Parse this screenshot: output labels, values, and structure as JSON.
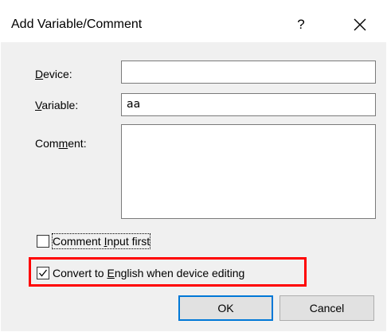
{
  "window": {
    "title": "Add Variable/Comment",
    "help_glyph": "?",
    "close_glyph": "close-icon"
  },
  "form": {
    "device": {
      "label_underline": "D",
      "label_rest": "evice:",
      "value": ""
    },
    "variable": {
      "label_underline": "V",
      "label_rest": "ariable:",
      "value": "aa"
    },
    "comment": {
      "label_pre": "Com",
      "label_underline": "m",
      "label_rest": "ent:",
      "value": ""
    }
  },
  "options": {
    "comment_input_first": {
      "label_pre": "Comment ",
      "label_underline": "I",
      "label_rest": "nput first",
      "checked": false
    },
    "convert_to_english": {
      "label_pre": "Convert to ",
      "label_underline": "E",
      "label_rest": "nglish when device editing",
      "checked": true
    }
  },
  "buttons": {
    "ok": "OK",
    "cancel": "Cancel"
  },
  "colors": {
    "highlight": "#ff0000",
    "default_button_border": "#0078d7",
    "client_background": "#f0f0f0"
  }
}
